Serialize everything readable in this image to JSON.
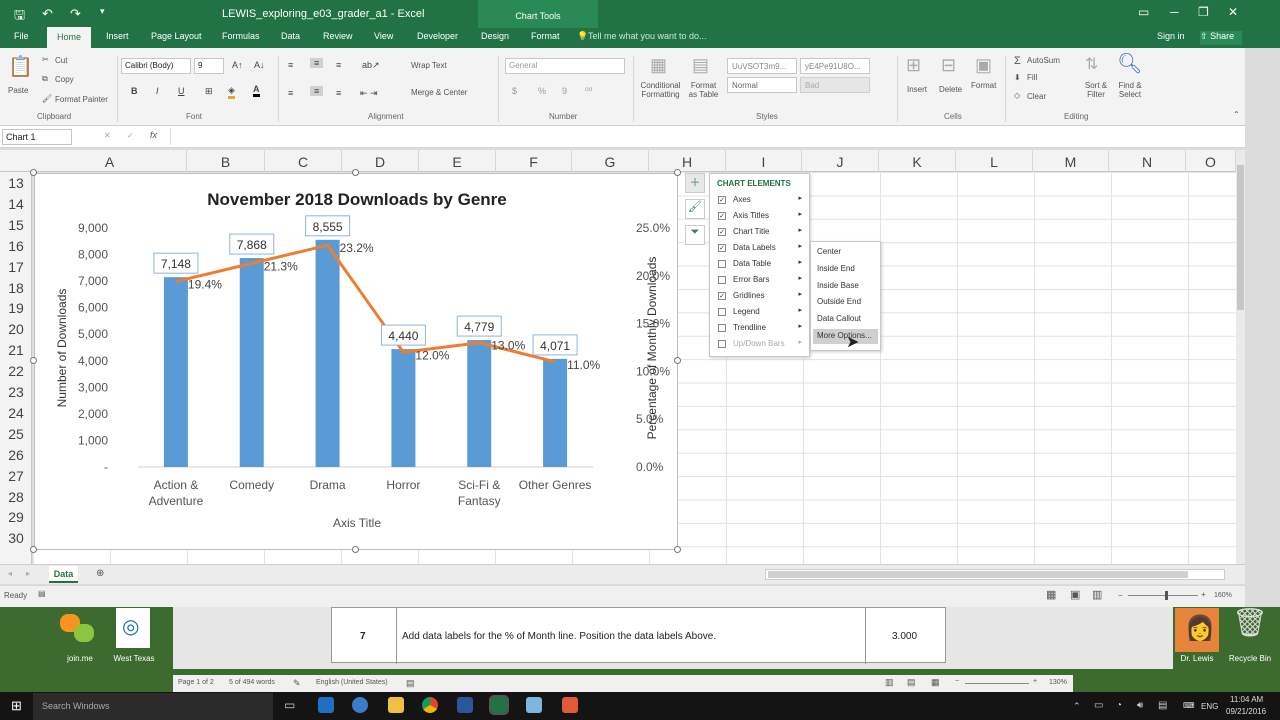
{
  "window": {
    "title": "LEWIS_exploring_e03_grader_a1 - Excel",
    "context_title": "Chart Tools",
    "controls": [
      "▭",
      "─",
      "❐",
      "✕"
    ]
  },
  "tabs": {
    "file": "File",
    "home": "Home",
    "insert": "Insert",
    "page_layout": "Page Layout",
    "formulas": "Formulas",
    "data": "Data",
    "review": "Review",
    "view": "View",
    "developer": "Developer",
    "design": "Design",
    "format": "Format",
    "tell_me": "Tell me what you want to do...",
    "sign_in": "Sign in",
    "share": "Share"
  },
  "ribbon": {
    "clipboard": {
      "paste": "Paste",
      "cut": "Cut",
      "copy": "Copy",
      "format_painter": "Format Painter",
      "group": "Clipboard"
    },
    "font": {
      "font_name": "Calibri (Body)",
      "font_size": "9",
      "bold": "B",
      "italic": "I",
      "underline": "U",
      "group": "Font"
    },
    "alignment": {
      "wrap_text": "Wrap Text",
      "merge_center": "Merge & Center",
      "group": "Alignment"
    },
    "number": {
      "format": "General",
      "currency": "$",
      "percent": "%",
      "comma": "9",
      "group": "Number"
    },
    "styles": {
      "conditional": "Conditional Formatting",
      "format_as_table": "Format as Table",
      "style1": "UuVSOT3m9...",
      "style2": "yE4Pe91U8O...",
      "normal": "Normal",
      "bad": "Bad",
      "group": "Styles"
    },
    "cells": {
      "insert": "Insert",
      "delete": "Delete",
      "format": "Format",
      "group": "Cells"
    },
    "editing": {
      "autosum": "AutoSum",
      "fill": "Fill",
      "clear": "Clear",
      "sort_filter": "Sort & Filter",
      "find_select": "Find & Select",
      "group": "Editing"
    }
  },
  "formula_bar": {
    "name_box": "Chart 1",
    "fx": "fx"
  },
  "columns": [
    "A",
    "B",
    "C",
    "D",
    "E",
    "F",
    "G",
    "H",
    "I",
    "J",
    "K",
    "L",
    "M",
    "N",
    "O"
  ],
  "rows": [
    "13",
    "14",
    "15",
    "16",
    "17",
    "18",
    "19",
    "20",
    "21",
    "22",
    "23",
    "24",
    "25",
    "26",
    "27",
    "28",
    "29",
    "30"
  ],
  "chart_data": {
    "type": "bar",
    "title": "November 2018 Downloads by Genre",
    "xlabel": "Axis Title",
    "ylabel": "Number of Downloads",
    "y2label": "Percentage of Monthly Downloads",
    "categories": [
      [
        "Action &",
        "Adventure"
      ],
      [
        "Comedy"
      ],
      [
        "Drama"
      ],
      [
        "Horror"
      ],
      [
        "Sci-Fi &",
        "Fantasy"
      ],
      [
        "Other Genres"
      ]
    ],
    "series": [
      {
        "type": "bar",
        "axis": "primary",
        "values": [
          7148,
          7868,
          8555,
          4440,
          4779,
          4071
        ],
        "labels": [
          "7,148",
          "7,868",
          "8,555",
          "4,440",
          "4,779",
          "4,071"
        ],
        "color": "#5b9bd5"
      },
      {
        "type": "line",
        "axis": "secondary",
        "values": [
          19.4,
          21.3,
          23.2,
          12.0,
          13.0,
          11.0
        ],
        "labels": [
          "19.4%",
          "21.3%",
          "23.2%",
          "12.0%",
          "13.0%",
          "11.0%"
        ],
        "color": "#ed7d31"
      }
    ],
    "ylim": [
      0,
      9000
    ],
    "y_ticks": [
      "-",
      "1,000",
      "2,000",
      "3,000",
      "4,000",
      "5,000",
      "6,000",
      "7,000",
      "8,000",
      "9,000"
    ],
    "y2lim": [
      0,
      25
    ],
    "y2_ticks": [
      "0.0%",
      "5.0%",
      "10.0%",
      "15.0%",
      "20.0%",
      "25.0%"
    ],
    "grid": false,
    "legend": "none"
  },
  "chart_elements": {
    "header": "CHART ELEMENTS",
    "items": [
      {
        "label": "Axes",
        "checked": true
      },
      {
        "label": "Axis Titles",
        "checked": true
      },
      {
        "label": "Chart Title",
        "checked": true
      },
      {
        "label": "Data Labels",
        "checked": true
      },
      {
        "label": "Data Table",
        "checked": false
      },
      {
        "label": "Error Bars",
        "checked": false
      },
      {
        "label": "Gridlines",
        "checked": true
      },
      {
        "label": "Legend",
        "checked": false
      },
      {
        "label": "Trendline",
        "checked": false
      },
      {
        "label": "Up/Down Bars",
        "checked": false
      }
    ],
    "submenu": [
      "Center",
      "Inside End",
      "Inside Base",
      "Outside End",
      "Data Callout",
      "More Options..."
    ]
  },
  "sheet": {
    "tab": "Data",
    "status": "Ready",
    "zoom": "160%"
  },
  "word": {
    "step": "7",
    "instruction": "Add data labels for the % of Month line. Position the data labels Above.",
    "points": "3.000",
    "page": "Page 1 of 2",
    "words": "5 of 494 words",
    "language": "English (United States)",
    "zoom": "130%"
  },
  "desktop": {
    "icon1": "join.me",
    "icon2": "West Texas",
    "icon3": "Dr. Lewis",
    "icon4": "Recycle Bin"
  },
  "taskbar": {
    "search": "Search Windows",
    "lang": "ENG",
    "time": "11:04 AM",
    "date": "09/21/2016"
  }
}
